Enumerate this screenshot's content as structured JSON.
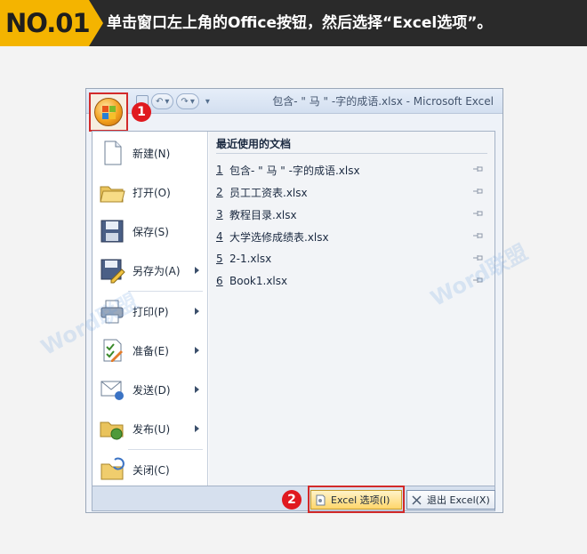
{
  "banner": {
    "step": "NO.01",
    "instruction": "单击窗口左上角的Office按钮，然后选择“Excel选项”。"
  },
  "window": {
    "title": "包含- \" 马 \" -字的成语.xlsx - Microsoft Excel",
    "qat": {
      "undo": "↶",
      "redo": "↷",
      "dropdown": "▾"
    }
  },
  "callouts": {
    "one": "1",
    "two": "2"
  },
  "menu": {
    "items": [
      {
        "label": "新建(N)",
        "icon": "new-document-icon",
        "submenu": false
      },
      {
        "label": "打开(O)",
        "icon": "open-folder-icon",
        "submenu": false
      },
      {
        "label": "保存(S)",
        "icon": "save-disk-icon",
        "submenu": false
      },
      {
        "label": "另存为(A)",
        "icon": "save-as-icon",
        "submenu": true
      },
      {
        "label": "打印(P)",
        "icon": "printer-icon",
        "submenu": true
      },
      {
        "label": "准备(E)",
        "icon": "prepare-icon",
        "submenu": true
      },
      {
        "label": "发送(D)",
        "icon": "send-icon",
        "submenu": true
      },
      {
        "label": "发布(U)",
        "icon": "publish-icon",
        "submenu": true
      },
      {
        "label": "关闭(C)",
        "icon": "close-folder-icon",
        "submenu": false
      }
    ],
    "recent_title": "最近使用的文档",
    "recent": [
      {
        "num": "1",
        "name": "包含- \" 马 \" -字的成语.xlsx"
      },
      {
        "num": "2",
        "name": "员工工资表.xlsx"
      },
      {
        "num": "3",
        "name": "教程目录.xlsx"
      },
      {
        "num": "4",
        "name": "大学选修成绩表.xlsx"
      },
      {
        "num": "5",
        "name": "2-1.xlsx"
      },
      {
        "num": "6",
        "name": "Book1.xlsx"
      }
    ],
    "options_button": "Excel 选项(I)",
    "exit_button": "退出 Excel(X)"
  },
  "watermark": "Word联盟",
  "colors": {
    "accent": "#f4b400",
    "highlight": "#d22a2a",
    "badge": "#e0191f"
  }
}
